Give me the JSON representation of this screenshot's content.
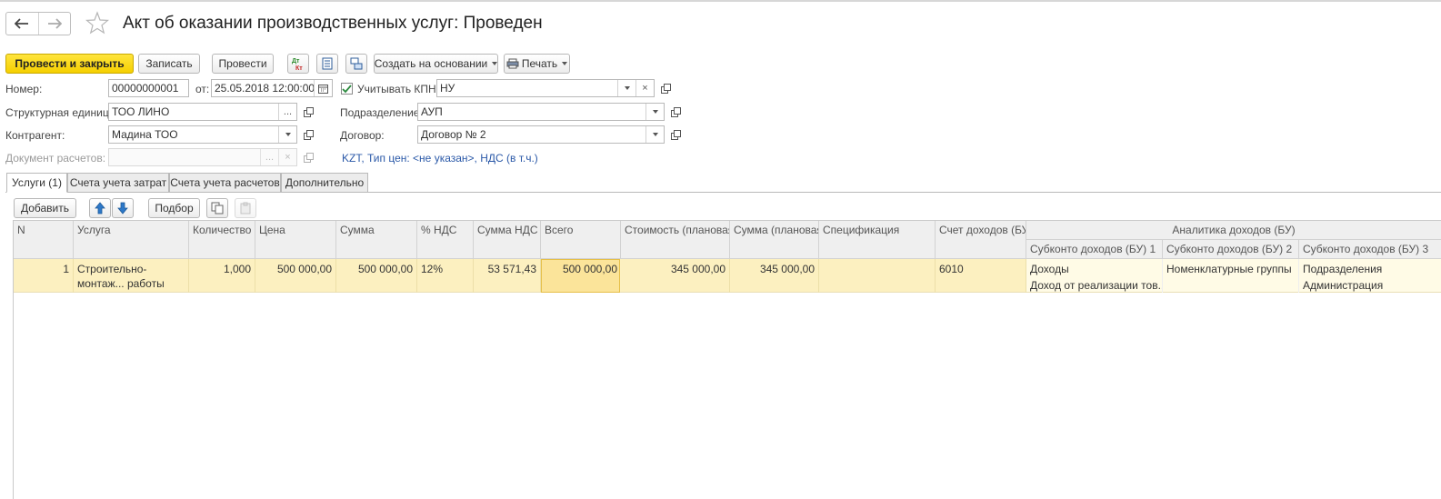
{
  "window": {
    "title": "Акт об оказании производственных услуг: Проведен"
  },
  "toolbar": {
    "post_close": "Провести и закрыть",
    "save": "Записать",
    "post": "Провести",
    "create_based_on": "Создать на основании",
    "print": "Печать"
  },
  "form": {
    "number_label": "Номер:",
    "number_value": "00000000001",
    "date_label": "от:",
    "date_value": "25.05.2018 12:00:00",
    "kpn_label": "Учитывать КПН",
    "kpn_value": "НУ",
    "kpn_checked": true,
    "unit_label": "Структурная единица:",
    "unit_value": "ТОО ЛИНО",
    "dept_label": "Подразделение:",
    "dept_value": "АУП",
    "counterparty_label": "Контрагент:",
    "counterparty_value": "Мадина ТОО",
    "contract_label": "Договор:",
    "contract_value": "Договор № 2",
    "settlement_doc_label": "Документ расчетов:",
    "settlement_doc_value": "",
    "price_info_link": "KZT, Тип цен: <не указан>, НДС (в т.ч.)"
  },
  "tabs": [
    {
      "label": "Услуги (1)",
      "active": true
    },
    {
      "label": "Счета учета затрат",
      "active": false
    },
    {
      "label": "Счета учета расчетов",
      "active": false
    },
    {
      "label": "Дополнительно",
      "active": false
    }
  ],
  "table_toolbar": {
    "add": "Добавить",
    "pick": "Подбор"
  },
  "table": {
    "headers": {
      "n": "N",
      "service": "Услуга",
      "qty": "Количество",
      "price": "Цена",
      "sum": "Сумма",
      "vat_rate": "% НДС",
      "vat_sum": "Сумма НДС",
      "total": "Всего",
      "plan_cost": "Стоимость (плановая)",
      "plan_sum": "Сумма (плановая)",
      "spec": "Специфика­ция",
      "income_account": "Счет доходов (БУ)",
      "analytics_group": "Аналитика доходов (БУ)",
      "subconto1": "Субконто доходов (БУ) 1",
      "subconto2": "Субконто доходов (БУ) 2",
      "subconto3": "Субконто доходов (БУ) 3"
    },
    "rows": [
      {
        "n": "1",
        "service": "Строительно-монтаж... работы",
        "qty": "1,000",
        "price": "500 000,00",
        "sum": "500 000,00",
        "vat_rate": "12%",
        "vat_sum": "53 571,43",
        "total": "500 000,00",
        "plan_cost": "345 000,00",
        "plan_sum": "345 000,00",
        "spec": "",
        "income_account": "6010",
        "subconto1_a": "Доходы",
        "subconto1_b": "Доход от реализации тов...",
        "subconto2_a": "Номенклатурные группы",
        "subconto3_a": "Подразделения",
        "subconto3_b": "Администрация"
      }
    ]
  },
  "colors": {
    "primary_button": "#f5cf00",
    "selected_row": "#fcf0c0",
    "link": "#2b59a8"
  }
}
